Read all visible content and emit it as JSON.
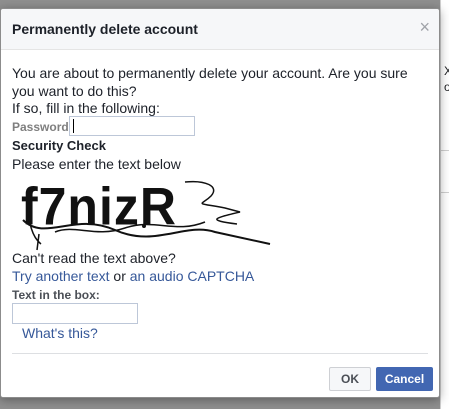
{
  "background": {
    "fragments": [
      "X",
      "o"
    ]
  },
  "dialog": {
    "title": "Permanently delete account",
    "close_glyph": "×",
    "intro": "You are about to permanently delete your account. Are you sure you want to do this?",
    "fill_note": "If so, fill in the following:",
    "password_label": "Password",
    "password_value": "",
    "security_check": "Security Check",
    "enter_text_prompt": "Please enter the text below",
    "captcha_text": "f7nizR",
    "cant_read": "Can't read the text above?",
    "try_another": "Try another text",
    "or_word": " or ",
    "audio_captcha": "an audio CAPTCHA",
    "text_in_box_label": "Text in the box:",
    "text_in_box_value": "",
    "whats_this": "What's this?",
    "ok_label": "OK",
    "cancel_label": "Cancel"
  },
  "colors": {
    "link": "#365899",
    "primary_button": "#4267b2",
    "header_bg": "#f6f7f9"
  }
}
